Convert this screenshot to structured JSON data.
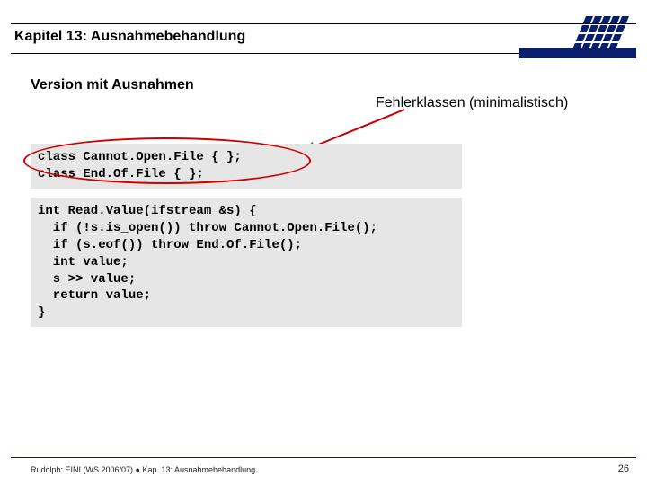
{
  "header": {
    "chapter_title": "Kapitel 13: Ausnahmebehandlung"
  },
  "subhead": "Version mit Ausnahmen",
  "annotation": "Fehlerklassen (minimalistisch)",
  "code_block_1": "class Cannot.Open.File { };\nclass End.Of.File { };",
  "code_block_2": "int Read.Value(ifstream &s) {\n  if (!s.is_open()) throw Cannot.Open.File();\n  if (s.eof()) throw End.Of.File();\n  int value;\n  s >> value;\n  return value;\n}",
  "footer": {
    "left": "Rudolph: EINI (WS 2006/07)  ●  Kap. 13: Ausnahmebehandlung",
    "page": "26"
  },
  "colors": {
    "navy": "#0a1f6b",
    "ellipse": "#cc0000",
    "arrow": "#cc0000",
    "arrowhead": "#009a00"
  }
}
